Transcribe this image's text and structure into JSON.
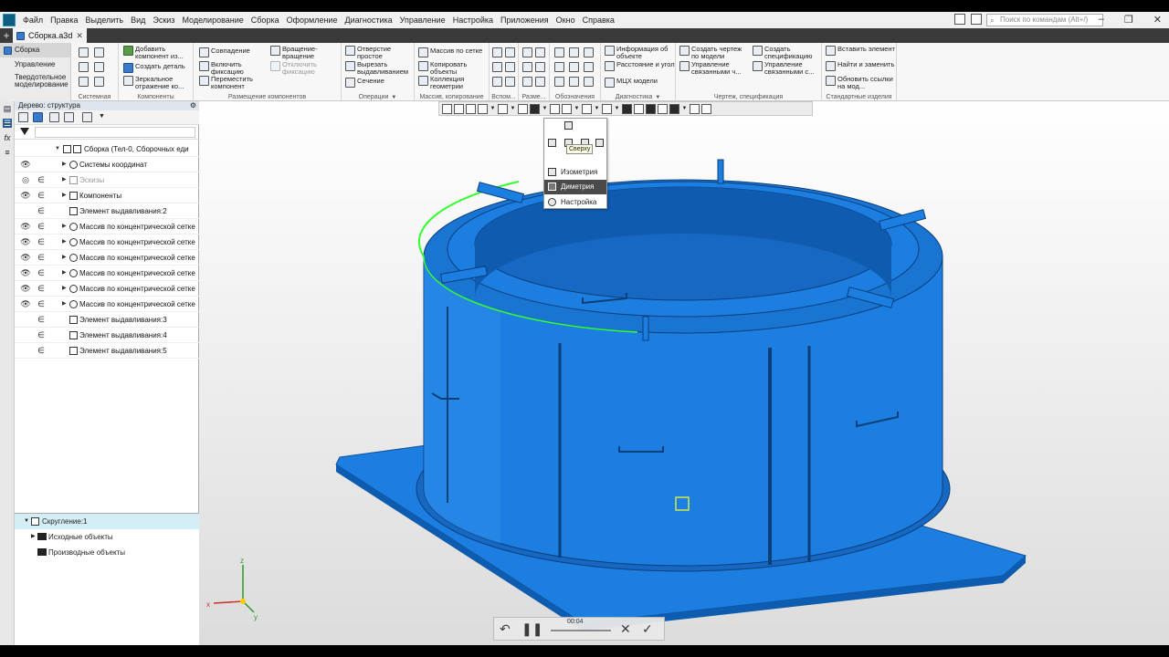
{
  "menu": [
    "Файл",
    "Правка",
    "Выделить",
    "Вид",
    "Эскиз",
    "Моделирование",
    "Сборка",
    "Оформление",
    "Диагностика",
    "Управление",
    "Настройка",
    "Приложения",
    "Окно",
    "Справка"
  ],
  "search_placeholder": "Поиск по командам (Alt+/)",
  "doc_tab": "Сборка.a3d",
  "modes": [
    "Сборка",
    "Управление",
    "Твердотельное моделирование"
  ],
  "ribbon": {
    "g1": {
      "cap": "Системная"
    },
    "g2": {
      "b1": "Добавить компонент из...",
      "b2": "Создать деталь",
      "b3": "Зеркальное отражение ко...",
      "cap": "Компоненты"
    },
    "g3": {
      "b1": "Совпадение",
      "b2": "Включить фиксацию",
      "b3": "Переместить компонент",
      "b4": "Вращение-вращение",
      "b5": "Отключить фиксацию",
      "cap": "Размещение компонентов"
    },
    "g4": {
      "b1": "Отверстие простое",
      "b2": "Вырезать выдавливанием",
      "b3": "Сечение",
      "cap": "Операции"
    },
    "g5": {
      "b1": "Массив по сетке",
      "b2": "Копировать объекты",
      "b3": "Коллекция геометрии",
      "cap": "Массив, копирование"
    },
    "g6": {
      "cap": "Вспом..."
    },
    "g7": {
      "cap": "Разме..."
    },
    "g8": {
      "cap": "Обозначения"
    },
    "g9": {
      "b1": "Информация об объекте",
      "b2": "Расстояние и угол",
      "b3": "МЦХ модели",
      "cap": "Диагностика"
    },
    "g10": {
      "b1": "Создать чертеж по модели",
      "b2": "Управление связанными ч...",
      "b3": "Создать спецификацию",
      "b4": "Управление связанными с...",
      "cap": "Чертеж, спецификация"
    },
    "g11": {
      "b1": "Вставить элемент",
      "b2": "Найти и заменить",
      "b3": "Обновить ссылки на мод...",
      "cap": "Стандартные изделия"
    }
  },
  "tree_title": "Дерево: структура",
  "tree": [
    {
      "label": "Сборка (Тел-0, Сборочных еди"
    },
    {
      "label": "Системы координат"
    },
    {
      "label": "Эскизы"
    },
    {
      "label": "Компоненты"
    },
    {
      "label": "Элемент выдавливания:2"
    },
    {
      "label": "Массив по концентрической сетке"
    },
    {
      "label": "Массив по концентрической сетке"
    },
    {
      "label": "Массив по концентрической сетке"
    },
    {
      "label": "Массив по концентрической сетке"
    },
    {
      "label": "Массив по концентрической сетке"
    },
    {
      "label": "Массив по концентрической сетке"
    },
    {
      "label": "Элемент выдавливания:3"
    },
    {
      "label": "Элемент выдавливания:4"
    },
    {
      "label": "Элемент выдавливания:5"
    }
  ],
  "props": [
    "Скругление:1",
    "Исходные объекты",
    "Производные объекты"
  ],
  "orient_menu": {
    "tooltip": "Сверху",
    "items": [
      "Изометрия",
      "Диметрия",
      "Настройка"
    ],
    "selected": "Диметрия"
  },
  "axes": {
    "z": "z",
    "x": "x",
    "y": "y"
  },
  "player": {
    "time": "00:04"
  },
  "colors": {
    "model": "#1c7ee0",
    "model_dark": "#0d5cb0",
    "highlight_edge": "#33ff33",
    "ribbon_bg": "#f7f7f7",
    "tree_selected": "#d4eef6"
  }
}
